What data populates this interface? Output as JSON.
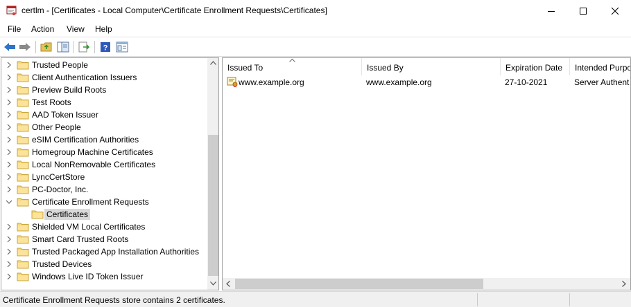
{
  "window": {
    "title": "certlm - [Certificates - Local Computer\\Certificate Enrollment Requests\\Certificates]"
  },
  "menu": {
    "file": "File",
    "action": "Action",
    "view": "View",
    "help": "Help"
  },
  "toolbar": {
    "buttons": [
      "back-icon",
      "forward-icon",
      "up-folder-icon",
      "show-hide-tree-icon",
      "export-list-icon",
      "help-icon",
      "properties-icon"
    ]
  },
  "tree": {
    "items": [
      {
        "label": "Trusted People",
        "expanded": false
      },
      {
        "label": "Client Authentication Issuers",
        "expanded": false
      },
      {
        "label": "Preview Build Roots",
        "expanded": false
      },
      {
        "label": "Test Roots",
        "expanded": false
      },
      {
        "label": "AAD Token Issuer",
        "expanded": false
      },
      {
        "label": "Other People",
        "expanded": false
      },
      {
        "label": "eSIM Certification Authorities",
        "expanded": false
      },
      {
        "label": "Homegroup Machine Certificates",
        "expanded": false
      },
      {
        "label": "Local NonRemovable Certificates",
        "expanded": false
      },
      {
        "label": "LyncCertStore",
        "expanded": false
      },
      {
        "label": "PC-Doctor, Inc.",
        "expanded": false
      },
      {
        "label": "Certificate Enrollment Requests",
        "expanded": true
      },
      {
        "label": "Certificates",
        "child": true,
        "selected": true
      },
      {
        "label": "Shielded VM Local Certificates",
        "expanded": false
      },
      {
        "label": "Smart Card Trusted Roots",
        "expanded": false
      },
      {
        "label": "Trusted Packaged App Installation Authorities",
        "expanded": false
      },
      {
        "label": "Trusted Devices",
        "expanded": false
      },
      {
        "label": "Windows Live ID Token Issuer",
        "expanded": false
      }
    ]
  },
  "list": {
    "columns": [
      "Issued To",
      "Issued By",
      "Expiration Date",
      "Intended Purpo"
    ],
    "rows": [
      {
        "issued_to": "www.example.org",
        "issued_by": "www.example.org",
        "expiration": "27-10-2021",
        "purpose": "Server Authent"
      }
    ]
  },
  "status": {
    "text": "Certificate Enrollment Requests store contains 2 certificates."
  },
  "colors": {
    "folder": "#f5d67b",
    "selection": "#d9d9d9",
    "scroll_thumb": "#cdcdcd"
  }
}
